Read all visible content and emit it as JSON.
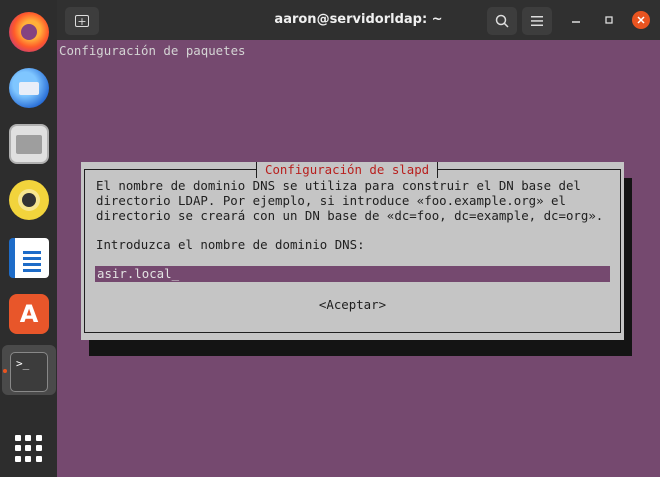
{
  "window": {
    "title": "aaron@servidorldap: ~"
  },
  "dock": {
    "items": [
      "firefox",
      "thunderbird",
      "files",
      "rhythmbox",
      "libreoffice-writer",
      "software-center",
      "terminal",
      "show-applications"
    ],
    "active": "terminal"
  },
  "terminal": {
    "header": "Configuración de paquetes",
    "dialog": {
      "title": "Configuración de slapd",
      "lines": [
        "El nombre de dominio DNS se utiliza para construir el DN base del",
        "directorio LDAP. Por ejemplo, si introduce «foo.example.org» el",
        "directorio se creará con un DN base de «dc=foo, dc=example, dc=org»."
      ],
      "prompt": "Introduzca el nombre de dominio DNS:",
      "input_value": "asir.local_",
      "ok_label": "<Aceptar>"
    }
  },
  "colors": {
    "terminal_bg": "#75496f",
    "dialog_bg": "#c5c5c5",
    "dialog_title": "#b8201e",
    "close_button": "#e95420"
  }
}
